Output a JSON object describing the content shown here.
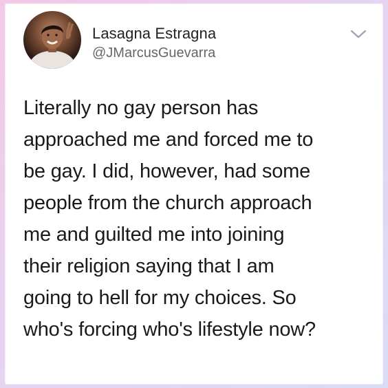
{
  "tweet": {
    "author_name": "Lasagna Estragna",
    "author_handle": "@JMarcusGuevarra",
    "avatar_icon": "profile-photo",
    "menu_icon": "chevron-down-icon",
    "text": "Literally no gay person has\napproached me and forced me to\nbe gay. I did, however, had some\npeople from the church approach\nme and guilted me into joining\ntheir religion saying that I am\ngoing to hell for my choices. So\nwho's forcing who's lifestyle now?"
  },
  "colors": {
    "background_gradient_start": "#f3c9e6",
    "background_gradient_end": "#d9dcf7",
    "card": "#ffffff",
    "name_text": "#222222",
    "handle_text": "#666666",
    "body_text": "#1a1a1a"
  }
}
